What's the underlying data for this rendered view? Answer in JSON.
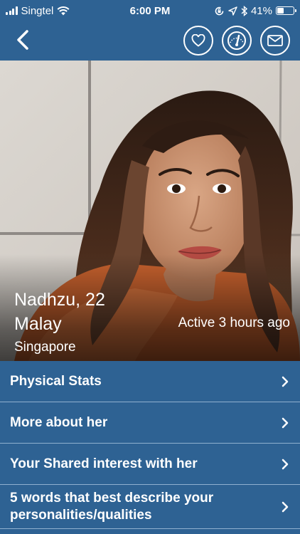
{
  "status_bar": {
    "carrier": "Singtel",
    "time": "6:00 PM",
    "battery_percent": "41%",
    "battery_level": 0.41,
    "icons": [
      "signal-icon",
      "wifi-icon",
      "orientation-lock-icon",
      "location-icon",
      "bluetooth-icon",
      "battery-icon"
    ]
  },
  "nav": {
    "back_icon": "chevron-left-icon",
    "actions": [
      "heart-icon",
      "gauge-icon",
      "mail-icon"
    ]
  },
  "profile": {
    "name_age": "Nadhzu, 22",
    "ethnicity": "Malay",
    "location": "Singapore",
    "active_status": "Active 3 hours ago"
  },
  "menu": {
    "items": [
      {
        "label": "Physical Stats"
      },
      {
        "label": "More about her"
      },
      {
        "label": "Your Shared interest with her"
      },
      {
        "label": "5 words that best describe your personalities/qualities"
      }
    ]
  },
  "colors": {
    "primary": "#2e6293",
    "divider": "#8fb0cf",
    "text": "#ffffff"
  }
}
